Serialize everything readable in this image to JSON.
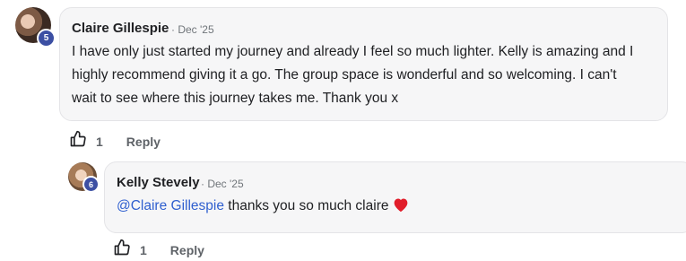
{
  "comment": {
    "author": "Claire Gillespie",
    "date": "· Dec '25",
    "level": "5",
    "text_lines": [
      "I have only just started my journey and already I feel so much lighter. Kelly is amazing and I",
      "highly recommend giving it a go. The group space is wonderful and so welcoming. I can't",
      "wait to see where this journey takes me. Thank you x"
    ],
    "like_count": "1",
    "reply_label": "Reply"
  },
  "reply": {
    "author": "Kelly Stevely",
    "date": "· Dec '25",
    "level": "6",
    "mention": "@Claire Gillespie",
    "text": " thanks you so much claire",
    "like_count": "1",
    "reply_label": "Reply"
  },
  "colors": {
    "mention": "#2f5fcf",
    "level_badge": "#3c4fa3",
    "heart": "#e11d2a"
  }
}
